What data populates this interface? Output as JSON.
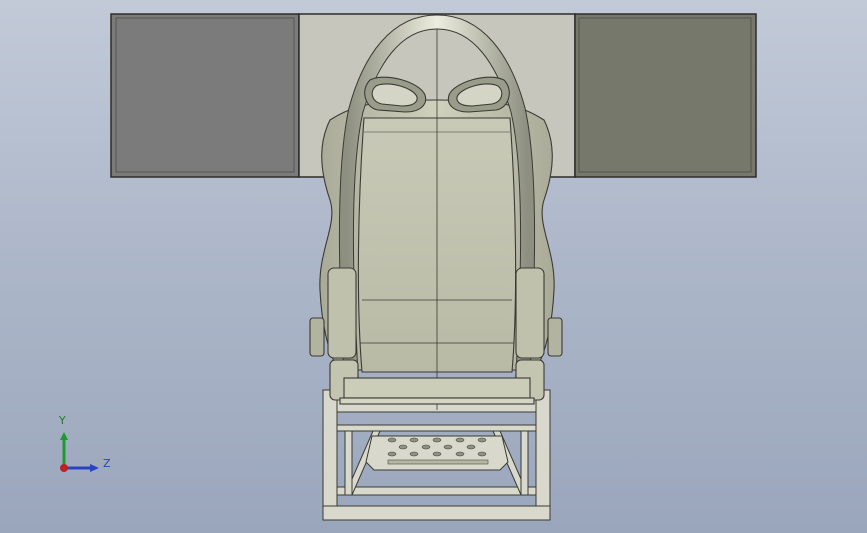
{
  "viewport": {
    "background_top": "#c2cad8",
    "background_bottom": "#9aa6bc"
  },
  "model": {
    "frame_color": "#d8d8cc",
    "seat_color": "#c9cbb6",
    "screen_left_color": "#7b7b7b",
    "screen_right_color": "#77786c",
    "screen_center_color": "#c6c6bc",
    "edge_color": "#3a3a34"
  },
  "triad": {
    "y_label": "Y",
    "z_label": "Z",
    "y_color": "#1e9a2e",
    "z_color": "#2a44c0",
    "x_color": "#c02020"
  }
}
